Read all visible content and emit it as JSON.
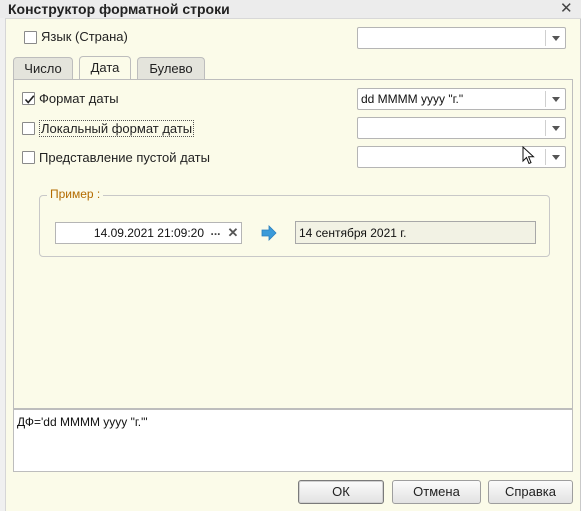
{
  "window": {
    "title": "Конструктор форматной строки"
  },
  "language": {
    "label": "Язык (Страна)",
    "checked": false,
    "value": ""
  },
  "tabs": [
    {
      "label": "Число",
      "active": false
    },
    {
      "label": "Дата",
      "active": true
    },
    {
      "label": "Булево",
      "active": false
    }
  ],
  "fields": {
    "date_format": {
      "label": "Формат даты",
      "checked": true,
      "value": "dd MMMM yyyy \"г.\""
    },
    "local_format": {
      "label": "Локальный формат даты",
      "checked": false,
      "value": ""
    },
    "empty_date": {
      "label": "Представление пустой даты",
      "checked": false,
      "value": ""
    }
  },
  "example": {
    "label": "Пример :",
    "input_value": "14.09.2021 21:09:20",
    "select_button": "...",
    "clear_button": "✕",
    "result_value": "14 сентября 2021 г."
  },
  "format_string": "ДФ='dd MMMM yyyy \"г.\"'",
  "buttons": {
    "ok": "ОК",
    "cancel": "Отмена",
    "help": "Справка"
  },
  "icons": {
    "close": "close-icon",
    "arrow": "arrow-right-icon",
    "check": "checkmark-icon"
  }
}
